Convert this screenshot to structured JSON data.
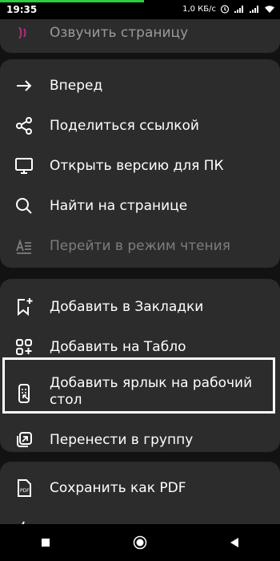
{
  "status": {
    "time": "19:35",
    "network": "1,0 КБ/с"
  },
  "menu": {
    "partial_top": "Озвучить страницу",
    "group1": [
      {
        "label": "Вперед",
        "icon": "arrow-right-icon"
      },
      {
        "label": "Поделиться ссылкой",
        "icon": "share-icon"
      },
      {
        "label": "Открыть версию для ПК",
        "icon": "desktop-icon"
      },
      {
        "label": "Найти на странице",
        "icon": "search-icon"
      },
      {
        "label": "Перейти в режим чтения",
        "icon": "reading-mode-icon"
      }
    ],
    "group2": [
      {
        "label": "Добавить в Закладки",
        "icon": "bookmark-add-icon"
      },
      {
        "label": "Добавить на Табло",
        "icon": "tiles-add-icon"
      },
      {
        "label": "Добавить ярлык на рабочий стол",
        "icon": "shortcut-add-icon"
      },
      {
        "label": "Перенести в группу",
        "icon": "move-group-icon"
      }
    ],
    "group3": [
      {
        "label": "Сохранить как PDF",
        "icon": "pdf-icon"
      }
    ]
  },
  "colors": {
    "menu_bg": "#2c2c2c",
    "screen_bg": "#121212",
    "dim_text": "#7d7d7d",
    "highlight": "#ffffff"
  }
}
